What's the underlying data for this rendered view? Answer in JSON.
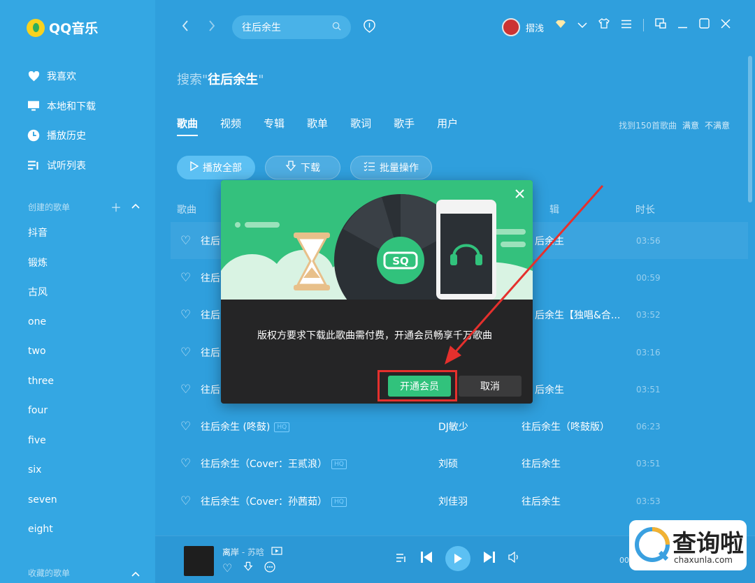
{
  "app": {
    "name": "QQ音乐"
  },
  "sidebar": {
    "nav": [
      {
        "label": "我喜欢",
        "icon": "heart-icon"
      },
      {
        "label": "本地和下载",
        "icon": "monitor-icon"
      },
      {
        "label": "播放历史",
        "icon": "clock-icon"
      },
      {
        "label": "试听列表",
        "icon": "playlist-icon"
      }
    ],
    "created_header": "创建的歌单",
    "playlists": [
      "抖音",
      "锻炼",
      "古风",
      "one",
      "two",
      "three",
      "four",
      "five",
      "six",
      "seven",
      "eight"
    ],
    "collected_header": "收藏的歌单"
  },
  "topbar": {
    "search_value": "往后余生",
    "username": "摺浅"
  },
  "search": {
    "prefix": "搜索\"",
    "keyword": "往后余生",
    "suffix": "\""
  },
  "tabs": [
    "歌曲",
    "视频",
    "专辑",
    "歌单",
    "歌词",
    "歌手",
    "用户"
  ],
  "result_info": {
    "count_text": "找到150首歌曲",
    "satisfied": "满意",
    "unsatisfied": "不满意"
  },
  "actions": {
    "play_all": "播放全部",
    "download": "下载",
    "batch": "批量操作"
  },
  "table": {
    "headers": {
      "song": "歌曲",
      "album": "辑",
      "duration": "时长"
    },
    "rows": [
      {
        "title": "往后",
        "artist": "",
        "album": "后余生",
        "duration": "03:56",
        "hq": false
      },
      {
        "title": "往后",
        "artist": "",
        "album": "",
        "duration": "00:59",
        "hq": false
      },
      {
        "title": "往后",
        "artist": "",
        "album": "后余生【独唱&合...",
        "duration": "03:52",
        "hq": false
      },
      {
        "title": "往后",
        "artist": "",
        "album": "",
        "duration": "03:16",
        "hq": false
      },
      {
        "title": "往后",
        "artist": "",
        "album": "后余生",
        "duration": "03:51",
        "hq": false
      },
      {
        "title": "往后余生 (咚鼓)",
        "artist": "DJ敏少",
        "album": "往后余生（咚鼓版）",
        "duration": "06:23",
        "hq": true
      },
      {
        "title": "往后余生（Cover：王贰浪）",
        "artist": "刘硕",
        "album": "往后余生",
        "duration": "03:51",
        "hq": true
      },
      {
        "title": "往后余生（Cover：孙茜茹）",
        "artist": "刘佳羽",
        "album": "往后余生",
        "duration": "03:53",
        "hq": true
      }
    ],
    "hq_label": "HQ"
  },
  "player": {
    "title": "离岸",
    "artist": "苏晗",
    "separator": " - ",
    "time": "00"
  },
  "dialog": {
    "banner_label": "SQ",
    "message": "版权方要求下载此歌曲需付费，开通会员畅享千万歌曲",
    "confirm": "开通会员",
    "cancel": "取消"
  },
  "watermark": {
    "text": "查询啦",
    "sub": "chaxunla.com"
  },
  "colors": {
    "bg": "#2f9fdd",
    "sidebar": "#34a7e3",
    "accent_green": "#31c27c",
    "dialog_bg": "#252526",
    "highlight_red": "#e5302d"
  }
}
